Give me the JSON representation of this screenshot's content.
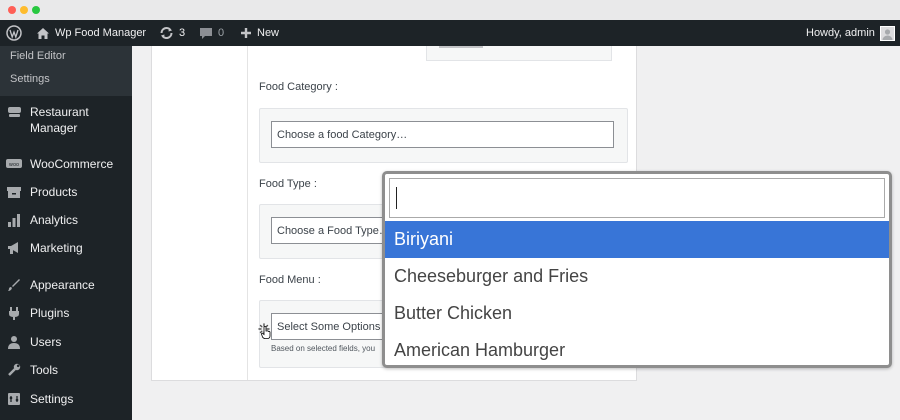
{
  "window": {
    "traffic_lights": [
      "#ff5f57",
      "#febc2e",
      "#28c840"
    ]
  },
  "admin_bar": {
    "site_name": "Wp Food Manager",
    "updates_count": "3",
    "comments_count": "0",
    "new_label": "New",
    "greeting": "Howdy, admin"
  },
  "sidebar": {
    "submenu": [
      "Field Editor",
      "Settings"
    ],
    "items": [
      {
        "label": "Restaurant Manager",
        "icon": "restaurant-icon"
      },
      {
        "label": "WooCommerce",
        "icon": "woocommerce-icon"
      },
      {
        "label": "Products",
        "icon": "products-icon"
      },
      {
        "label": "Analytics",
        "icon": "analytics-icon"
      },
      {
        "label": "Marketing",
        "icon": "marketing-icon"
      },
      {
        "label": "Appearance",
        "icon": "appearance-icon"
      },
      {
        "label": "Plugins",
        "icon": "plugins-icon"
      },
      {
        "label": "Users",
        "icon": "users-icon"
      },
      {
        "label": "Tools",
        "icon": "tools-icon"
      },
      {
        "label": "Settings",
        "icon": "settings-icon"
      }
    ]
  },
  "form": {
    "food_category": {
      "label": "Food Category :",
      "placeholder": "Choose a food Category…"
    },
    "food_type": {
      "label": "Food Type :",
      "placeholder": "Choose a Food Type…"
    },
    "food_menu": {
      "label": "Food Menu :",
      "placeholder": "Select Some Options",
      "help": "Based on selected fields, you"
    }
  },
  "dropdown": {
    "search_value": "",
    "options": [
      "Biriyani",
      "Cheeseburger and Fries",
      "Butter Chicken",
      "American Hamburger"
    ],
    "highlighted_index": 0
  },
  "colors": {
    "admin_bg": "#1d2327",
    "highlight": "#3875d7"
  }
}
